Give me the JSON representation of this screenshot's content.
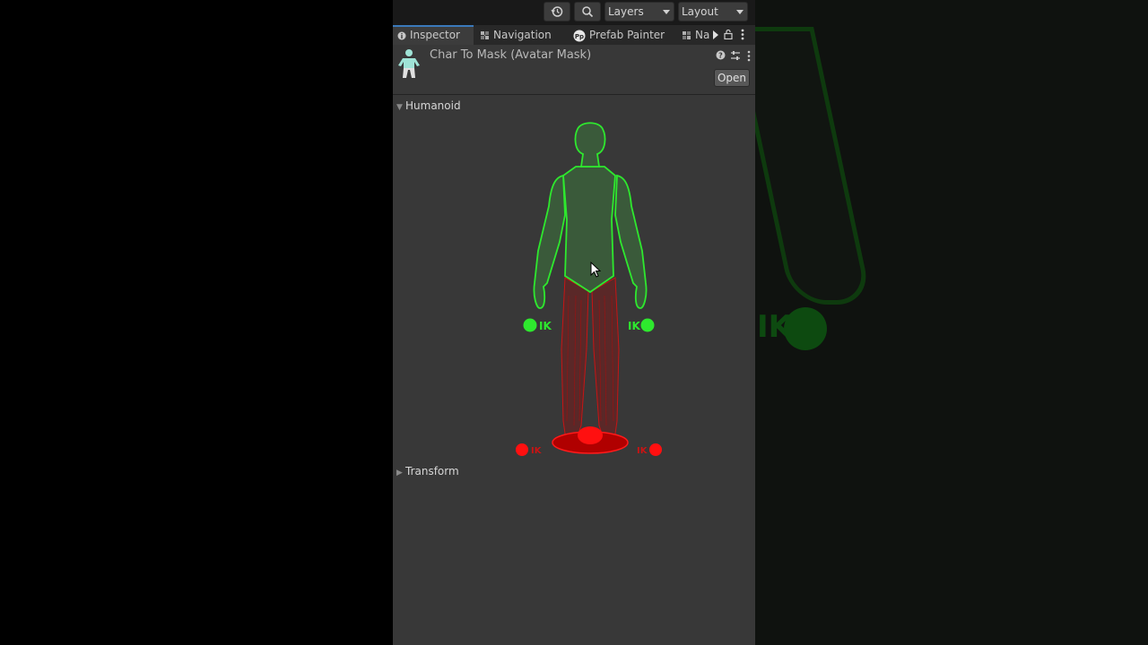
{
  "toolbar": {
    "layers_label": "Layers",
    "layout_label": "Layout",
    "history_icon": "history-icon",
    "search_icon": "search-icon"
  },
  "tabs": [
    {
      "label": "Inspector",
      "icon": "info-icon",
      "active": true
    },
    {
      "label": "Navigation",
      "icon": "navmesh-icon"
    },
    {
      "label": "Prefab Painter",
      "icon": "prefab-painter-icon"
    },
    {
      "label": "Na",
      "icon": "navmesh-icon"
    }
  ],
  "header": {
    "title": "Char To Mask (Avatar Mask)",
    "open_label": "Open"
  },
  "sections": {
    "humanoid": "Humanoid",
    "transform": "Transform"
  },
  "avatar_mask": {
    "ik_label": "IK",
    "enabled_color": "#2ee82e",
    "disabled_color": "#e81010",
    "enabled_parts": [
      "head",
      "body",
      "left-arm",
      "right-arm",
      "left-hand-ik",
      "right-hand-ik"
    ],
    "disabled_parts": [
      "left-leg",
      "right-leg",
      "root",
      "left-foot-ik",
      "right-foot-ik"
    ]
  },
  "colors": {
    "panel_bg": "#383838",
    "toolbar_bg": "#191919",
    "active_tab_accent": "#3a79bb"
  }
}
